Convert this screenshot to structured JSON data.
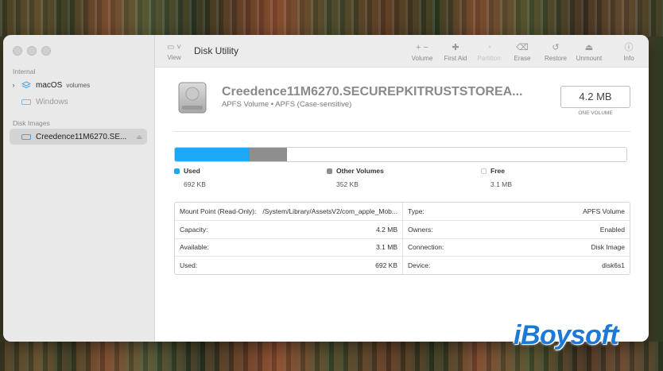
{
  "window": {
    "title": "Disk Utility"
  },
  "toolbar": {
    "view_label": "View",
    "buttons": [
      {
        "label": "Volume",
        "glyph": "+  −",
        "enabled": true
      },
      {
        "label": "First Aid",
        "glyph": "✚",
        "enabled": true
      },
      {
        "label": "Partition",
        "glyph": "◔",
        "enabled": false
      },
      {
        "label": "Erase",
        "glyph": "⌫",
        "enabled": true
      },
      {
        "label": "Restore",
        "glyph": "↺",
        "enabled": true
      },
      {
        "label": "Unmount",
        "glyph": "⏏",
        "enabled": true
      },
      {
        "label": "Info",
        "glyph": "ⓘ",
        "enabled": true
      }
    ]
  },
  "sidebar": {
    "section_internal": "Internal",
    "internal_items": [
      {
        "label": "macOS",
        "sub": "volumes",
        "icon": "layers-icon"
      },
      {
        "label": "Windows",
        "sub": "",
        "icon": "drive-icon"
      }
    ],
    "section_images": "Disk Images",
    "image_items": [
      {
        "label": "Creedence11M6270.SE...",
        "icon": "drive-icon"
      }
    ]
  },
  "volume": {
    "name": "Creedence11M6270.SECUREPKITRUSTSTOREA...",
    "description": "APFS Volume • APFS (Case-sensitive)",
    "size": "4.2 MB",
    "size_caption": "ONE VOLUME"
  },
  "usage": {
    "segments": [
      {
        "label": "Used",
        "value": "692 KB",
        "color": "#1ea7f2",
        "fraction": 0.165
      },
      {
        "label": "Other Volumes",
        "value": "352 KB",
        "color": "#8e8e8e",
        "fraction": 0.084
      },
      {
        "label": "Free",
        "value": "3.1 MB",
        "color": "#ffffff",
        "fraction": 0.751
      }
    ]
  },
  "info": {
    "left": [
      {
        "key": "Mount Point (Read-Only):",
        "value": "/System/Library/AssetsV2/com_apple_Mob..."
      },
      {
        "key": "Capacity:",
        "value": "4.2 MB"
      },
      {
        "key": "Available:",
        "value": "3.1 MB"
      },
      {
        "key": "Used:",
        "value": "692 KB"
      }
    ],
    "right": [
      {
        "key": "Type:",
        "value": "APFS Volume"
      },
      {
        "key": "Owners:",
        "value": "Enabled"
      },
      {
        "key": "Connection:",
        "value": "Disk Image"
      },
      {
        "key": "Device:",
        "value": "disk6s1"
      }
    ]
  },
  "watermark": "iBoysoft"
}
